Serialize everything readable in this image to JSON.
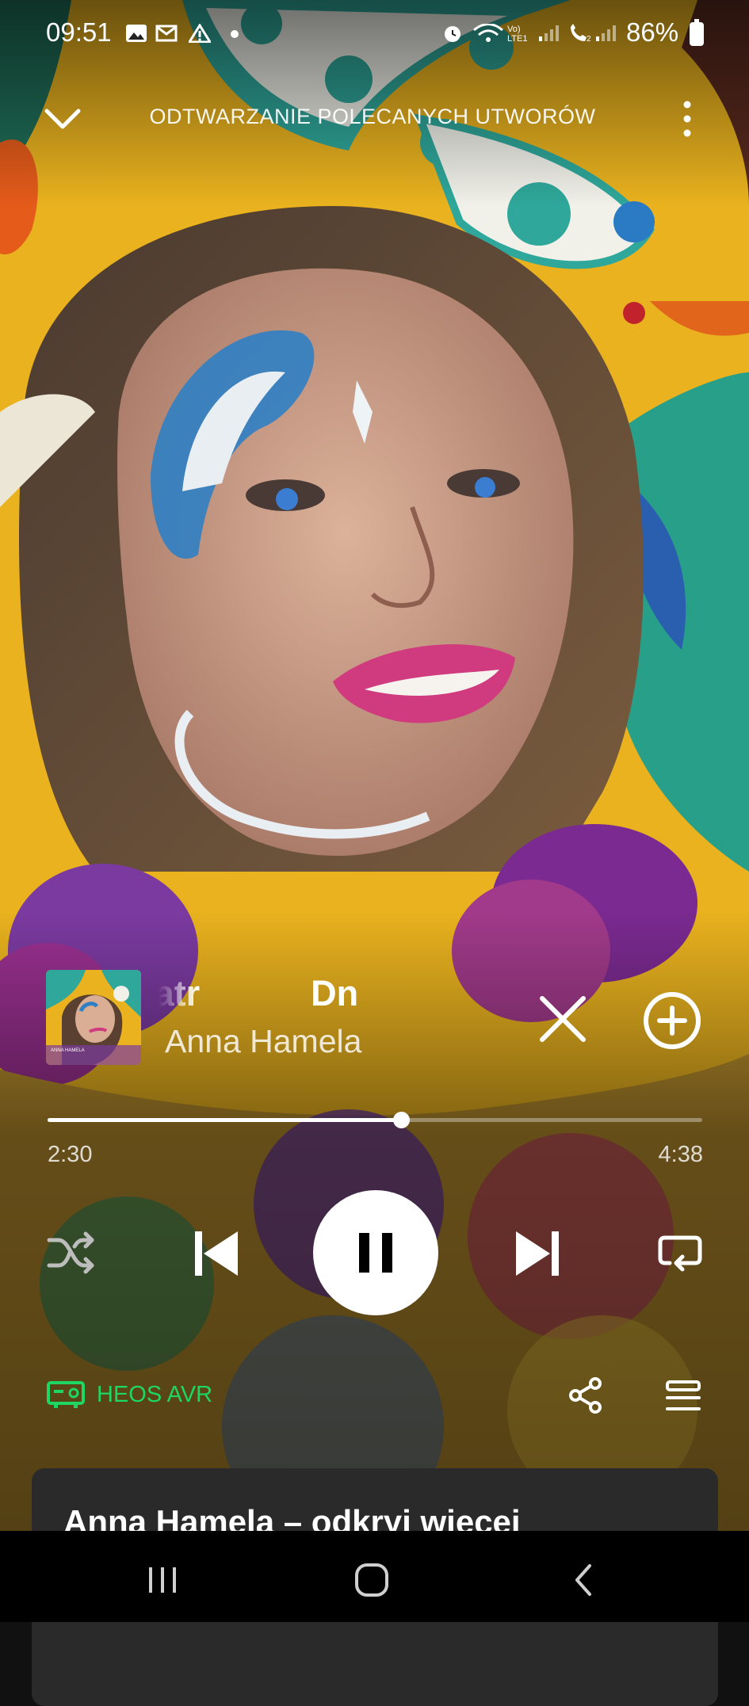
{
  "status_bar": {
    "time": "09:51",
    "battery": "86%",
    "icons": [
      "gallery-icon",
      "mail-icon",
      "warning-icon",
      "dot-icon",
      "alarm-icon",
      "wifi-icon",
      "volte-signal-icon",
      "call-signal-icon",
      "battery-icon"
    ]
  },
  "header": {
    "title": "ODTWARZANIE POLECANYCH UTWORÓW",
    "collapse_icon": "chevron-down-icon",
    "more_icon": "more-vert-icon"
  },
  "now_playing": {
    "title_visible": "ce, wiatr",
    "title_next_visible": "Dn",
    "artist": "Anna Hamela",
    "thumbnail_caption": "ANNA HAMELA"
  },
  "progress": {
    "elapsed": "2:30",
    "total": "4:38",
    "fraction": 0.54
  },
  "controls": {
    "shuffle": "shuffle-icon",
    "previous": "skip-previous-icon",
    "play_state": "playing",
    "next": "skip-next-icon",
    "repeat": "repeat-icon"
  },
  "device": {
    "label": "HEOS AVR",
    "color": "#1ed760"
  },
  "artist_card": {
    "title": "Anna Hamela – odkryj więcej"
  },
  "colors": {
    "accent": "#1ed760",
    "card": "#2a2a2a"
  }
}
